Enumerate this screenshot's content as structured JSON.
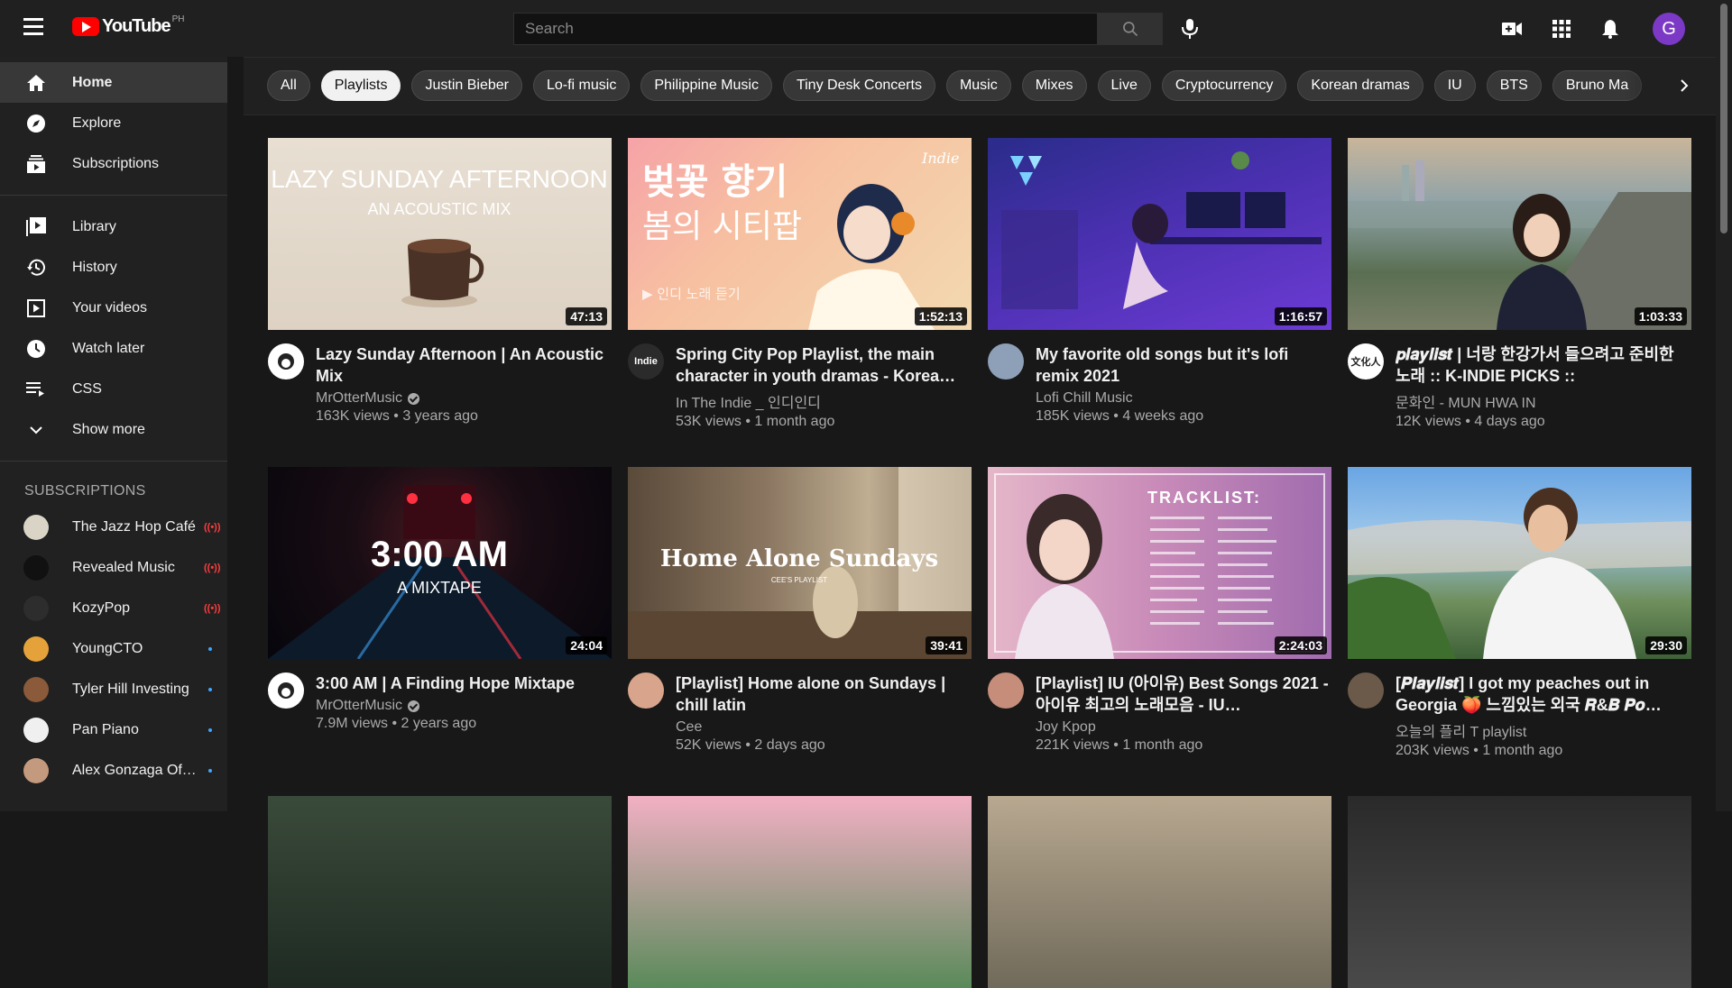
{
  "header": {
    "logo_text": "YouTube",
    "country_code": "PH",
    "search_placeholder": "Search",
    "avatar_letter": "G"
  },
  "sidebar": {
    "main": [
      {
        "label": "Home",
        "icon": "home-icon",
        "active": true
      },
      {
        "label": "Explore",
        "icon": "compass-icon"
      },
      {
        "label": "Subscriptions",
        "icon": "subscriptions-icon"
      }
    ],
    "library": [
      {
        "label": "Library",
        "icon": "library-icon"
      },
      {
        "label": "History",
        "icon": "history-icon"
      },
      {
        "label": "Your videos",
        "icon": "your-videos-icon"
      },
      {
        "label": "Watch later",
        "icon": "clock-icon"
      },
      {
        "label": "CSS",
        "icon": "playlist-icon"
      },
      {
        "label": "Show more",
        "icon": "chevron-down-icon"
      }
    ],
    "subscriptions_heading": "SUBSCRIPTIONS",
    "subscriptions": [
      {
        "name": "The Jazz Hop Café",
        "status": "live",
        "color": "#d9d4c6"
      },
      {
        "name": "Revealed Music",
        "status": "live",
        "color": "#111111"
      },
      {
        "name": "KozyPop",
        "status": "live",
        "color": "#2d2d2d"
      },
      {
        "name": "YoungCTO",
        "status": "new",
        "color": "#e6a23a"
      },
      {
        "name": "Tyler Hill Investing",
        "status": "new",
        "color": "#8a5a3a"
      },
      {
        "name": "Pan Piano",
        "status": "new",
        "color": "#f0f0f0"
      },
      {
        "name": "Alex Gonzaga Offi...",
        "status": "new",
        "color": "#c49a7e"
      }
    ]
  },
  "chips": [
    "All",
    "Playlists",
    "Justin Bieber",
    "Lo-fi music",
    "Philippine Music",
    "Tiny Desk Concerts",
    "Music",
    "Mixes",
    "Live",
    "Cryptocurrency",
    "Korean dramas",
    "IU",
    "BTS",
    "Bruno Ma"
  ],
  "selected_chip": "Playlists",
  "videos": [
    {
      "title": "Lazy Sunday Afternoon | An Acoustic Mix",
      "channel": "MrOtterMusic",
      "verified": true,
      "stats": "163K views • 3 years ago",
      "duration": "47:13",
      "thumb_text": "LAZY SUNDAY AFTERNOON",
      "thumb_sub": "AN ACOUSTIC MIX",
      "avatar_color": "#ffffff"
    },
    {
      "title": "Spring City Pop Playlist, the main character in youth dramas - Korea…",
      "channel": "In The Indie _ 인디인디",
      "verified": false,
      "stats": "53K views • 1 month ago",
      "duration": "1:52:13",
      "thumb_text": "벚꽃 향기",
      "thumb_sub": "봄의 시티팝",
      "thumb_extra": "▶ 인디 노래 듣기",
      "thumb_badge": "Indie",
      "avatar_color": "#2b2b2b"
    },
    {
      "title": "My favorite old songs but it's lofi remix 2021",
      "channel": "Lofi Chill Music",
      "verified": false,
      "stats": "185K views • 4 weeks ago",
      "duration": "1:16:57",
      "avatar_color": "#8ea0b8"
    },
    {
      "title": "𝒑𝒍𝒂𝒚𝒍𝒊𝒔𝒕 | 너랑 한강가서 들으려고 준비한 노래 :: K-INDIE PICKS ::",
      "channel": "문화인 - MUN HWA IN",
      "verified": false,
      "stats": "12K views • 4 days ago",
      "duration": "1:03:33",
      "avatar_text": "文化人",
      "avatar_color": "#ffffff"
    },
    {
      "title": "3:00 AM | A Finding Hope Mixtape",
      "channel": "MrOtterMusic",
      "verified": true,
      "stats": "7.9M views • 2 years ago",
      "duration": "24:04",
      "thumb_text": "3:00 AM",
      "thumb_sub": "A MIXTAPE",
      "avatar_color": "#ffffff"
    },
    {
      "title": "[Playlist] Home alone on Sundays | chill latin",
      "channel": "Cee",
      "verified": false,
      "stats": "52K views • 2 days ago",
      "duration": "39:41",
      "thumb_text": "Home Alone Sundays",
      "thumb_sub": "CEE'S PLAYLIST",
      "avatar_color": "#d8a48c"
    },
    {
      "title": "[Playlist] IU (아이유) Best Songs 2021 - 아이유 최고의 노래모음 - IU…",
      "channel": "Joy Kpop",
      "verified": false,
      "stats": "221K views • 1 month ago",
      "duration": "2:24:03",
      "thumb_text": "TRACKLIST:",
      "avatar_color": "#c58d7a"
    },
    {
      "title": "[𝑷𝒍𝒂𝒚𝒍𝒊𝒔𝒕] I got my peaches out in Georgia 🍑 느낌있는 외국 𝑹&𝑩 𝑷𝒐…",
      "channel": "오늘의 플리 T playlist",
      "verified": false,
      "stats": "203K views • 1 month ago",
      "duration": "29:30",
      "avatar_color": "#6b5a4a"
    }
  ]
}
